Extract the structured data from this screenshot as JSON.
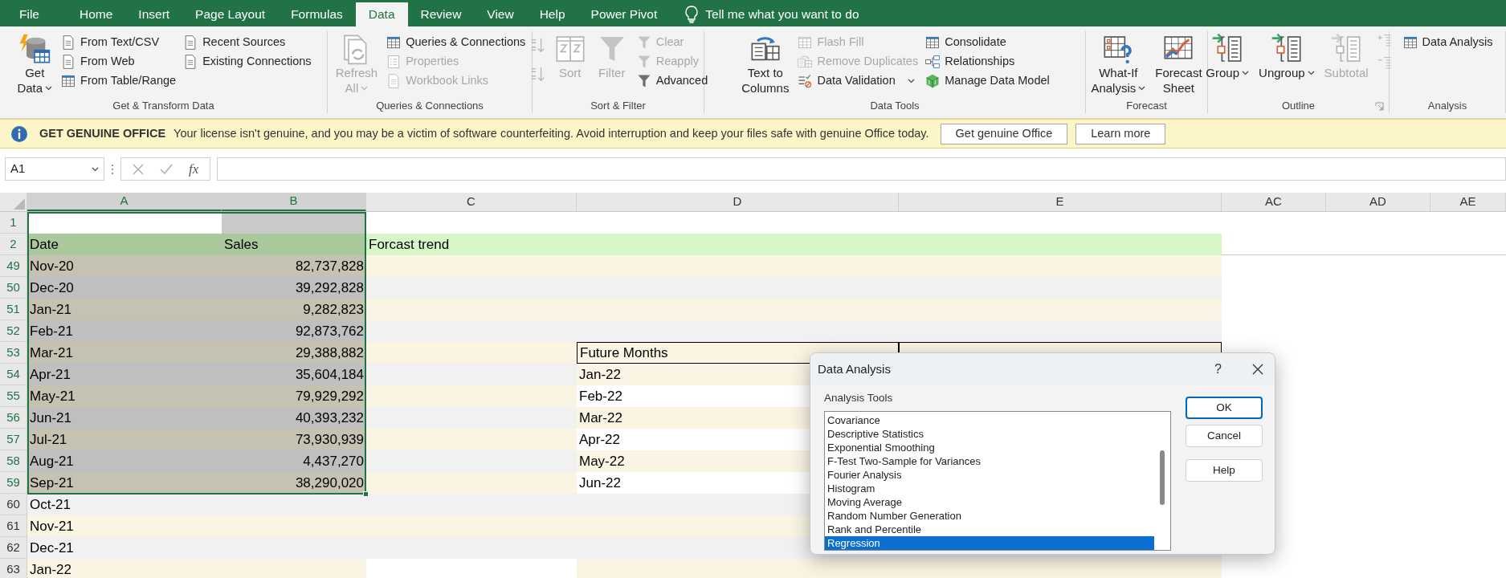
{
  "ribbon_tabs": [
    {
      "label": "File",
      "selected": false
    },
    {
      "label": "Home",
      "selected": false
    },
    {
      "label": "Insert",
      "selected": false
    },
    {
      "label": "Page Layout",
      "selected": false
    },
    {
      "label": "Formulas",
      "selected": false
    },
    {
      "label": "Data",
      "selected": true
    },
    {
      "label": "Review",
      "selected": false
    },
    {
      "label": "View",
      "selected": false
    },
    {
      "label": "Help",
      "selected": false
    },
    {
      "label": "Power Pivot",
      "selected": false
    }
  ],
  "tell_me": "Tell me what you want to do",
  "ribbon_groups": [
    {
      "label": "Get & Transform Data",
      "launcher": false,
      "controls": [
        {
          "kind": "large",
          "lines": [
            "Get",
            "Data"
          ],
          "dropdown": true,
          "disabled": false
        },
        {
          "kind": "stack",
          "items": [
            {
              "label": "From Text/CSV",
              "dropdown": false,
              "disabled": false
            },
            {
              "label": "From Web",
              "dropdown": false,
              "disabled": false
            },
            {
              "label": "From Table/Range",
              "dropdown": false,
              "disabled": false
            }
          ]
        },
        {
          "kind": "stack",
          "items": [
            {
              "label": "Recent Sources",
              "dropdown": false,
              "disabled": false
            },
            {
              "label": "Existing Connections",
              "dropdown": false,
              "disabled": false
            }
          ]
        }
      ]
    },
    {
      "label": "Queries & Connections",
      "launcher": false,
      "controls": [
        {
          "kind": "large",
          "lines": [
            "Refresh",
            "All"
          ],
          "dropdown": true,
          "disabled": true
        },
        {
          "kind": "stack",
          "items": [
            {
              "label": "Queries & Connections",
              "dropdown": false,
              "disabled": false
            },
            {
              "label": "Properties",
              "dropdown": false,
              "disabled": true
            },
            {
              "label": "Workbook Links",
              "dropdown": false,
              "disabled": true
            }
          ]
        }
      ]
    },
    {
      "label": "Sort & Filter",
      "launcher": false,
      "controls": [
        {
          "kind": "sort-buttons",
          "disabled": true
        },
        {
          "kind": "large",
          "lines": [
            "Sort"
          ],
          "dropdown": false,
          "disabled": true
        },
        {
          "kind": "large",
          "lines": [
            "Filter"
          ],
          "dropdown": false,
          "disabled": true
        },
        {
          "kind": "stack",
          "items": [
            {
              "label": "Clear",
              "dropdown": false,
              "disabled": true
            },
            {
              "label": "Reapply",
              "dropdown": false,
              "disabled": true
            },
            {
              "label": "Advanced",
              "dropdown": false,
              "disabled": false
            }
          ]
        }
      ]
    },
    {
      "label": "Data Tools",
      "launcher": false,
      "controls": [
        {
          "kind": "large",
          "lines": [
            "Text to",
            "Columns"
          ],
          "dropdown": false,
          "disabled": false
        },
        {
          "kind": "stack",
          "items": [
            {
              "label": "Flash Fill",
              "dropdown": false,
              "disabled": true
            },
            {
              "label": "Remove Duplicates",
              "dropdown": false,
              "disabled": true
            },
            {
              "label": "Data Validation",
              "dropdown": true,
              "disabled": false
            }
          ]
        },
        {
          "kind": "stack",
          "items": [
            {
              "label": "Consolidate",
              "dropdown": false,
              "disabled": false
            },
            {
              "label": "Relationships",
              "dropdown": false,
              "disabled": false
            },
            {
              "label": "Manage Data Model",
              "dropdown": false,
              "disabled": false
            }
          ]
        }
      ]
    },
    {
      "label": "Forecast",
      "launcher": false,
      "controls": [
        {
          "kind": "large",
          "lines": [
            "What-If",
            "Analysis"
          ],
          "dropdown": true,
          "disabled": false
        },
        {
          "kind": "large",
          "lines": [
            "Forecast",
            "Sheet"
          ],
          "dropdown": false,
          "disabled": false
        }
      ]
    },
    {
      "label": "Outline",
      "launcher": true,
      "controls": [
        {
          "kind": "large",
          "lines": [
            "Group"
          ],
          "dropdown": true,
          "disabled": false
        },
        {
          "kind": "large",
          "lines": [
            "Ungroup"
          ],
          "dropdown": true,
          "disabled": false
        },
        {
          "kind": "large",
          "lines": [
            "Subtotal"
          ],
          "dropdown": false,
          "disabled": true
        },
        {
          "kind": "expand-buttons",
          "disabled": true
        }
      ]
    },
    {
      "label": "Analysis",
      "launcher": false,
      "controls": [
        {
          "kind": "stack",
          "items": [
            {
              "label": "Data Analysis",
              "dropdown": false,
              "disabled": false
            }
          ]
        }
      ]
    }
  ],
  "banner": {
    "title": "GET GENUINE OFFICE",
    "message": "Your license isn't genuine, and you may be a victim of software counterfeiting. Avoid interruption and keep your files safe with genuine Office today.",
    "buttons": [
      "Get genuine Office",
      "Learn more"
    ]
  },
  "formula_bar": {
    "name_box": "A1",
    "function_button": "fx"
  },
  "sheet": {
    "columns": [
      {
        "label": "A",
        "selected": true
      },
      {
        "label": "B",
        "selected": true
      },
      {
        "label": "C",
        "selected": false
      },
      {
        "label": "D",
        "selected": false
      },
      {
        "label": "E",
        "selected": false
      },
      {
        "label": "AC",
        "selected": false
      },
      {
        "label": "AD",
        "selected": false
      },
      {
        "label": "AE",
        "selected": false
      }
    ],
    "rows": [
      {
        "number": "1",
        "selected": true,
        "table_header": false,
        "cells": {}
      },
      {
        "number": "2",
        "selected": true,
        "table_header": false,
        "cells": {
          "A": "Date",
          "B": "Sales",
          "C": "Forcast trend"
        }
      },
      {
        "number": "49",
        "selected": true,
        "table_header": false,
        "cells": {
          "A": "Nov-20",
          "B": "82,737,828"
        }
      },
      {
        "number": "50",
        "selected": true,
        "table_header": false,
        "cells": {
          "A": "Dec-20",
          "B": "39,292,828"
        }
      },
      {
        "number": "51",
        "selected": true,
        "table_header": false,
        "cells": {
          "A": "Jan-21",
          "B": "9,282,823"
        }
      },
      {
        "number": "52",
        "selected": true,
        "table_header": false,
        "cells": {
          "A": "Feb-21",
          "B": "92,873,762"
        }
      },
      {
        "number": "53",
        "selected": true,
        "table_header": true,
        "cells": {
          "A": "Mar-21",
          "B": "29,388,882",
          "D": "Future Months"
        }
      },
      {
        "number": "54",
        "selected": true,
        "table_header": false,
        "cells": {
          "A": "Apr-21",
          "B": "35,604,184",
          "D": "Jan-22"
        }
      },
      {
        "number": "55",
        "selected": true,
        "table_header": false,
        "cells": {
          "A": "May-21",
          "B": "79,929,292",
          "D": "Feb-22"
        }
      },
      {
        "number": "56",
        "selected": true,
        "table_header": false,
        "cells": {
          "A": "Jun-21",
          "B": "40,393,232",
          "D": "Mar-22"
        }
      },
      {
        "number": "57",
        "selected": true,
        "table_header": false,
        "cells": {
          "A": "Jul-21",
          "B": "73,930,939",
          "D": "Apr-22"
        }
      },
      {
        "number": "58",
        "selected": true,
        "table_header": false,
        "cells": {
          "A": "Aug-21",
          "B": "4,437,270",
          "D": "May-22"
        }
      },
      {
        "number": "59",
        "selected": true,
        "table_header": false,
        "cells": {
          "A": "Sep-21",
          "B": "38,290,020",
          "D": "Jun-22"
        }
      },
      {
        "number": "60",
        "selected": false,
        "table_header": false,
        "cells": {
          "A": "Oct-21"
        }
      },
      {
        "number": "61",
        "selected": false,
        "table_header": false,
        "cells": {
          "A": "Nov-21"
        }
      },
      {
        "number": "62",
        "selected": false,
        "table_header": false,
        "cells": {
          "A": "Dec-21"
        }
      },
      {
        "number": "63",
        "selected": false,
        "table_header": false,
        "cells": {
          "A": "Jan-22"
        }
      }
    ]
  },
  "dialog": {
    "title": "Data Analysis",
    "help": "?",
    "list_label": "Analysis Tools",
    "tools": [
      {
        "label": "Covariance",
        "selected": false
      },
      {
        "label": "Descriptive Statistics",
        "selected": false
      },
      {
        "label": "Exponential Smoothing",
        "selected": false
      },
      {
        "label": "F-Test Two-Sample for Variances",
        "selected": false
      },
      {
        "label": "Fourier Analysis",
        "selected": false
      },
      {
        "label": "Histogram",
        "selected": false
      },
      {
        "label": "Moving Average",
        "selected": false
      },
      {
        "label": "Random Number Generation",
        "selected": false
      },
      {
        "label": "Rank and Percentile",
        "selected": false
      },
      {
        "label": "Regression",
        "selected": true
      }
    ],
    "buttons": [
      {
        "label": "OK",
        "default": true
      },
      {
        "label": "Cancel",
        "default": false
      },
      {
        "label": "Help",
        "default": false
      }
    ]
  }
}
